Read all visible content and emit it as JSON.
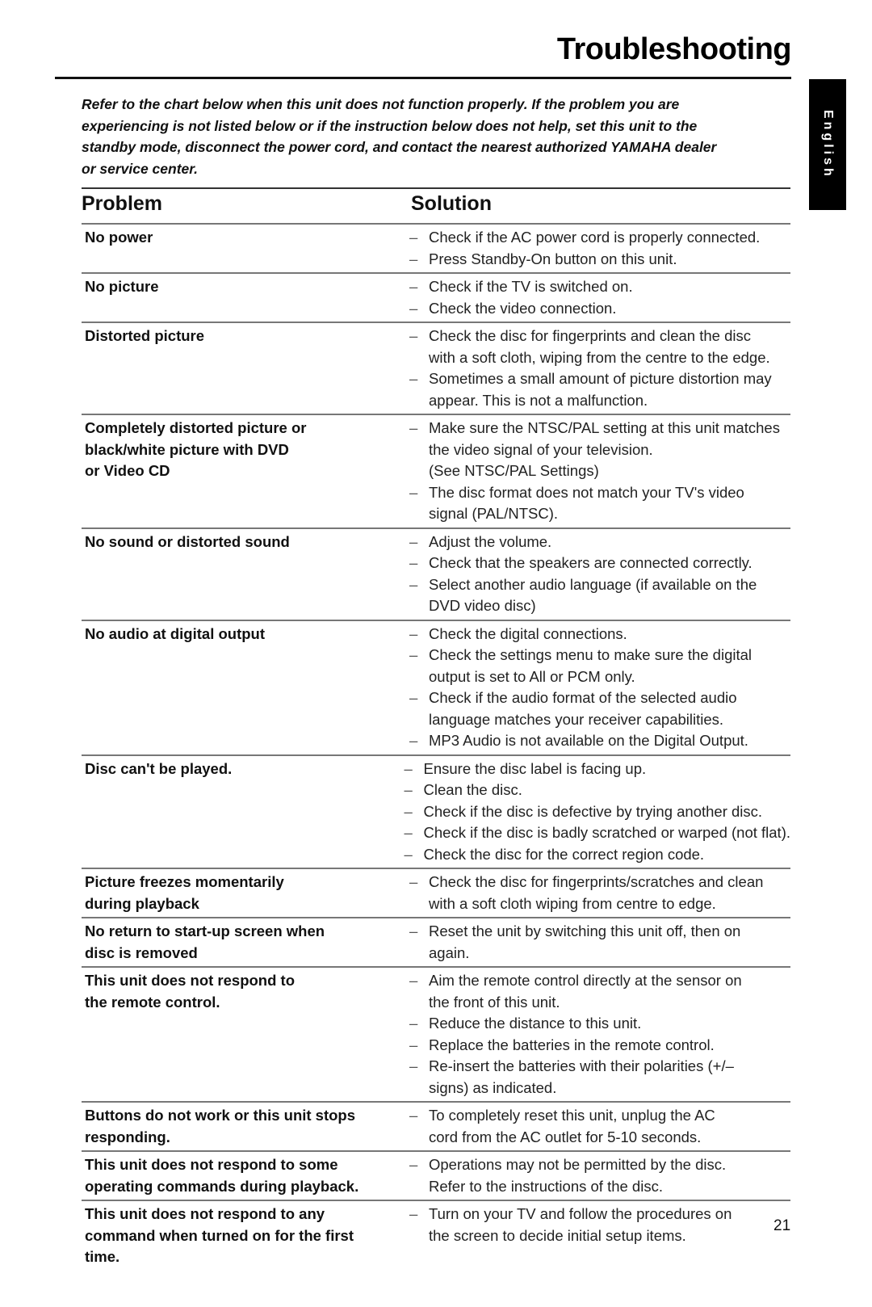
{
  "page": {
    "title": "Troubleshooting",
    "language_tab": "English",
    "page_number": "21"
  },
  "intro_lines": [
    "Refer to the chart below when this unit does not function properly. If the problem you are",
    "experiencing is not listed below or if the instruction below does not help, set this unit to the",
    "standby mode, disconnect the power cord, and contact the nearest authorized YAMAHA dealer",
    "or service center."
  ],
  "table": {
    "header_problem": "Problem",
    "header_solution": "Solution",
    "rows": [
      {
        "problem": [
          "No power"
        ],
        "solutions": [
          {
            "bullet": true,
            "lines": [
              "Check if the AC power cord is properly connected."
            ]
          },
          {
            "bullet": true,
            "lines": [
              "Press Standby-On button on this unit."
            ]
          }
        ]
      },
      {
        "problem": [
          "No picture"
        ],
        "solutions": [
          {
            "bullet": true,
            "lines": [
              "Check if the TV is switched on."
            ]
          },
          {
            "bullet": true,
            "lines": [
              "Check the video connection."
            ]
          }
        ]
      },
      {
        "problem": [
          "Distorted picture"
        ],
        "solutions": [
          {
            "bullet": true,
            "lines": [
              "Check the disc for fingerprints and clean the disc",
              "with a soft cloth, wiping from the centre to the edge."
            ]
          },
          {
            "bullet": true,
            "lines": [
              "Sometimes a small amount of picture distortion may",
              "appear. This is not a malfunction."
            ]
          }
        ]
      },
      {
        "problem": [
          "Completely distorted picture or",
          "black/white picture with DVD",
          "or Video CD"
        ],
        "solutions": [
          {
            "bullet": true,
            "lines": [
              "Make sure the NTSC/PAL setting at this unit matches",
              "the video signal of your television.",
              "(See NTSC/PAL Settings)"
            ]
          },
          {
            "bullet": true,
            "lines": [
              "The disc format does not match your TV's video",
              "signal (PAL/NTSC)."
            ]
          }
        ]
      },
      {
        "problem": [
          "No sound or distorted sound"
        ],
        "solutions": [
          {
            "bullet": true,
            "lines": [
              "Adjust the volume."
            ]
          },
          {
            "bullet": true,
            "lines": [
              "Check that the speakers are connected correctly."
            ]
          },
          {
            "bullet": true,
            "lines": [
              "Select another audio language (if available on the",
              "DVD video disc)"
            ]
          }
        ]
      },
      {
        "problem": [
          "No audio at digital output"
        ],
        "solutions": [
          {
            "bullet": true,
            "lines": [
              "Check the digital connections."
            ]
          },
          {
            "bullet": true,
            "lines": [
              "Check the settings menu to make sure the digital",
              "output is set to All or PCM only."
            ]
          },
          {
            "bullet": true,
            "lines": [
              "Check if the audio format of the selected audio",
              "language matches your receiver capabilities."
            ]
          },
          {
            "bullet": true,
            "lines": [
              "MP3 Audio is not available on the Digital Output."
            ]
          }
        ]
      },
      {
        "problem": [
          "Disc can't be played."
        ],
        "solutions": [
          {
            "bullet": true,
            "lines": [
              "Ensure the disc label is facing up."
            ]
          },
          {
            "bullet": true,
            "lines": [
              "Clean the disc."
            ]
          },
          {
            "bullet": true,
            "lines": [
              "Check if the disc is defective by trying another disc."
            ]
          },
          {
            "bullet": true,
            "lines": [
              "Check if the disc is badly scratched or warped (not flat)."
            ]
          },
          {
            "bullet": true,
            "lines": [
              "Check the disc for the correct region code."
            ]
          }
        ]
      },
      {
        "problem": [
          "Picture freezes momentarily",
          "during playback"
        ],
        "solutions": [
          {
            "bullet": true,
            "lines": [
              "Check the disc for fingerprints/scratches and clean",
              "with a soft cloth wiping from centre to edge."
            ]
          }
        ]
      },
      {
        "problem": [
          "No return to start-up screen when",
          "disc is removed"
        ],
        "solutions": [
          {
            "bullet": true,
            "lines": [
              "Reset the unit by switching this unit off, then on",
              "again."
            ]
          }
        ]
      },
      {
        "problem": [
          "This unit does not respond to",
          "the remote control."
        ],
        "solutions": [
          {
            "bullet": true,
            "lines": [
              "Aim the remote control directly at the sensor on",
              "the front of this unit."
            ]
          },
          {
            "bullet": true,
            "lines": [
              "Reduce the distance to this unit."
            ]
          },
          {
            "bullet": true,
            "lines": [
              "Replace the batteries in the remote control."
            ]
          },
          {
            "bullet": true,
            "lines": [
              "Re-insert the batteries with their polarities (+/–",
              "signs) as indicated."
            ]
          }
        ]
      },
      {
        "problem": [
          "Buttons do not work or this unit stops",
          "responding."
        ],
        "solutions": [
          {
            "bullet": true,
            "lines": [
              "To completely reset this unit, unplug the AC",
              "cord from the AC outlet for 5-10 seconds."
            ]
          }
        ]
      },
      {
        "problem": [
          "This unit does not respond to some",
          "operating commands during playback."
        ],
        "solutions": [
          {
            "bullet": true,
            "lines": [
              "Operations may not be permitted by the disc.",
              "Refer to the instructions of  the disc."
            ]
          }
        ]
      },
      {
        "problem": [
          "This unit does not respond to any",
          "command when turned on for the first",
          "time."
        ],
        "solutions": [
          {
            "bullet": true,
            "lines": [
              "Turn on your TV and follow the procedures on",
              "the screen to decide initial setup items."
            ]
          }
        ]
      }
    ]
  }
}
